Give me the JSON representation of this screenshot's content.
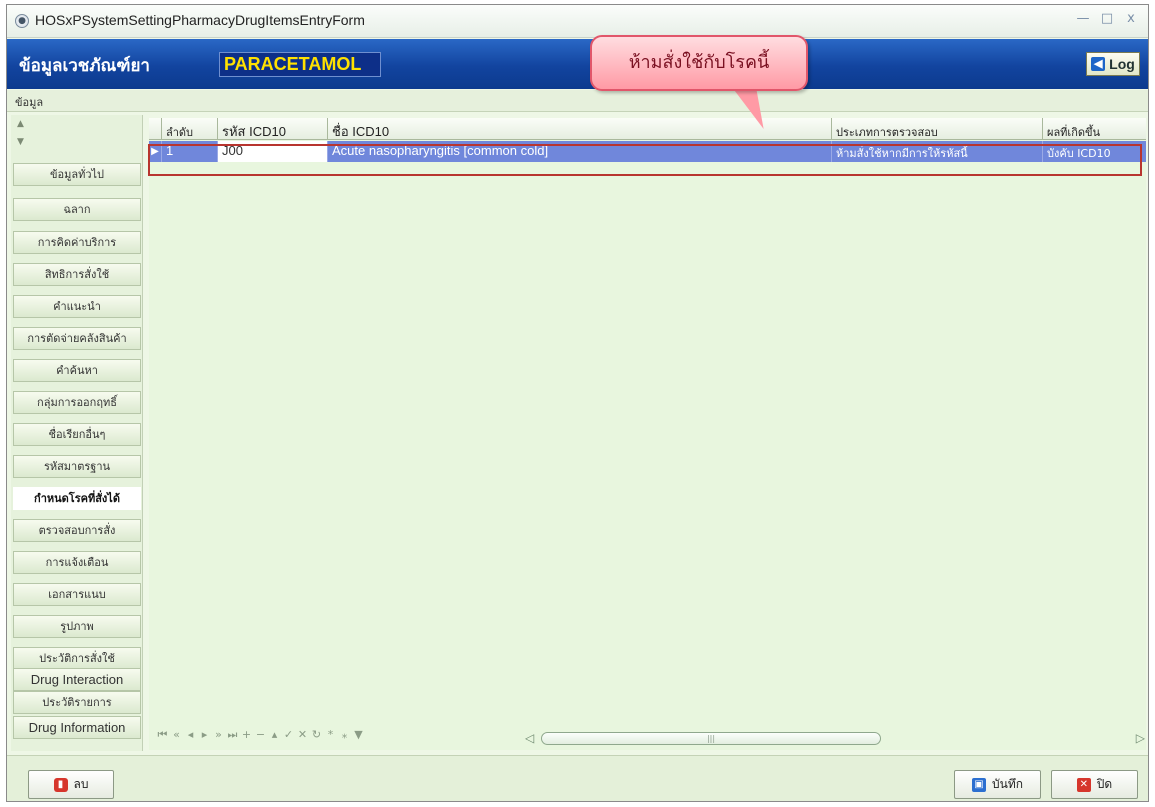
{
  "window": {
    "title": "HOSxPSystemSettingPharmacyDrugItemsEntryForm",
    "controls": [
      "—",
      "□",
      "x"
    ]
  },
  "header": {
    "title": "ข้อมูลเวชภัณฑ์ยา",
    "drug_name": "PARACETAMOL",
    "log_label": "Log"
  },
  "callout": {
    "text": "ห้ามสั่งใช้กับโรคนี้"
  },
  "menubar": {
    "item": "ข้อมูล"
  },
  "sidebar": {
    "items": [
      {
        "label": "ข้อมูลทั่วไป"
      },
      {
        "label": "ฉลาก"
      },
      {
        "label": "การคิดค่าบริการ"
      },
      {
        "label": "สิทธิการสั่งใช้"
      },
      {
        "label": "คำแนะนำ"
      },
      {
        "label": "การตัดจ่ายคลังสินค้า"
      },
      {
        "label": "คำค้นหา"
      },
      {
        "label": "กลุ่มการออกฤทธิ์"
      },
      {
        "label": "ชื่อเรียกอื่นๆ"
      },
      {
        "label": "รหัสมาตรฐาน"
      },
      {
        "label": "กำหนดโรคที่สั่งได้"
      },
      {
        "label": "ตรวจสอบการสั่ง"
      },
      {
        "label": "การแจ้งเตือน"
      },
      {
        "label": "เอกสารแนบ"
      },
      {
        "label": "รูปภาพ"
      },
      {
        "label": "ประวัติการสั่งใช้"
      },
      {
        "label": "Drug Interaction"
      },
      {
        "label": "ประวัติรายการ"
      },
      {
        "label": "Drug Information"
      }
    ],
    "active": "กำหนดโรคที่สั่งได้"
  },
  "grid": {
    "columns": [
      "ลำดับ",
      "รหัส ICD10",
      "ชื่อ ICD10",
      "ประเภทการตรวจสอบ",
      "ผลที่เกิดขึ้น"
    ],
    "rows": [
      {
        "order": "1",
        "icd10": "J00",
        "name": "Acute nasopharyngitis [common cold]",
        "check_type": "ห้ามสั่งใช้หากมีการให้รหัสนี้",
        "result": "บังคับ ICD10"
      }
    ]
  },
  "footer": {
    "delete_label": "ลบ",
    "save_label": "บันทึก",
    "close_label": "ปิด"
  },
  "colors": {
    "header_blue": "#12449f",
    "drug_name_yellow": "#ffe100",
    "selected_row": "#7087db",
    "highlight_border": "#b8352f"
  }
}
